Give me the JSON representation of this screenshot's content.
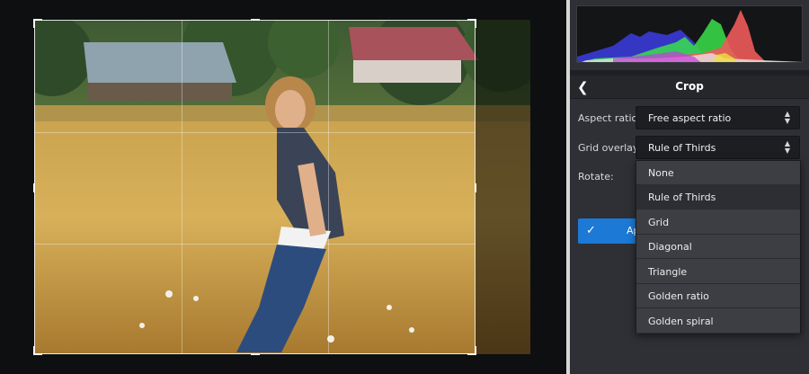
{
  "panel": {
    "title": "Crop",
    "back_icon": "chevron-left-icon",
    "aspect_ratio": {
      "label": "Aspect ratio:",
      "value": "Free aspect ratio"
    },
    "grid_overlay": {
      "label": "Grid overlay:",
      "value": "Rule of Thirds"
    },
    "rotate": {
      "label": "Rotate:"
    },
    "apply": {
      "label": "Ap",
      "icon": "checkmark-icon"
    },
    "dropdown_options": [
      "None",
      "Rule of Thirds",
      "Grid",
      "Diagonal",
      "Triangle",
      "Golden ratio",
      "Golden spiral"
    ],
    "selected_option": "Rule of Thirds"
  },
  "colors": {
    "accent": "#1d79d6",
    "panel_bg": "#2e3035"
  }
}
